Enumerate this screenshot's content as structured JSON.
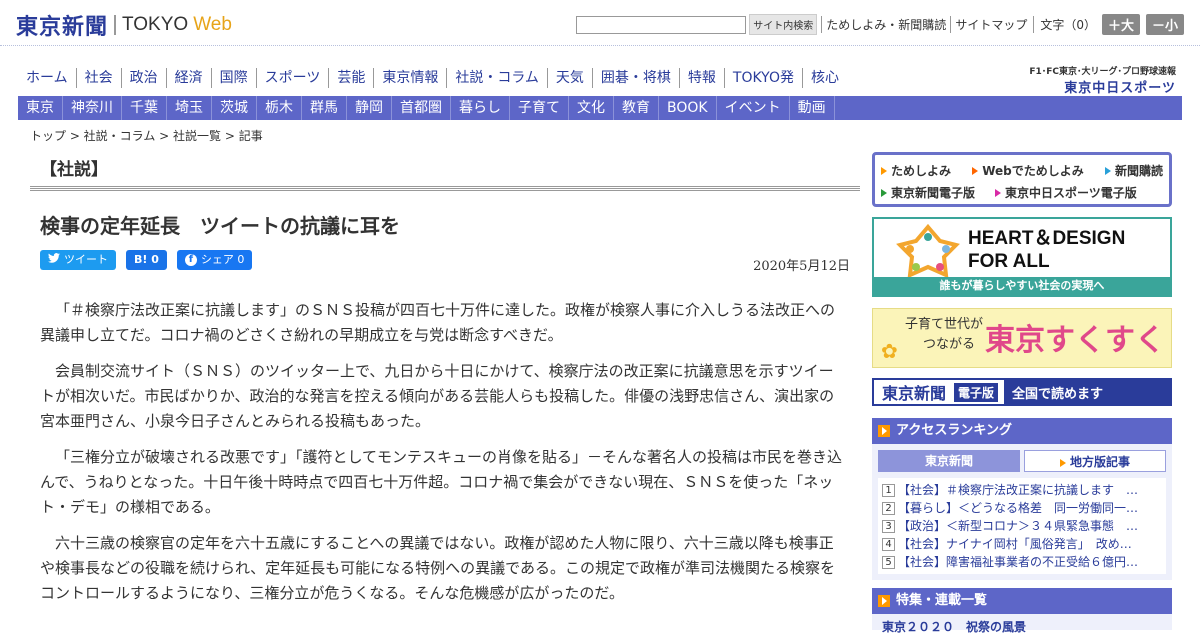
{
  "header": {
    "logo_jp": "東京新聞",
    "logo_en": "TOKYO",
    "logo_web": "Web",
    "search_button": "サイト内検索",
    "links": [
      "ためしよみ・新聞購読",
      "サイトマップ"
    ],
    "fontsize_label": "文字（0）",
    "size_up": "＋大",
    "size_down": "－小"
  },
  "nav_main": [
    "ホーム",
    "社会",
    "政治",
    "経済",
    "国際",
    "スポーツ",
    "芸能",
    "東京情報",
    "社説・コラム",
    "天気",
    "囲碁・将棋",
    "特報",
    "TOKYO発",
    "核心"
  ],
  "chunichi": {
    "small": "F1･FC東京･大リーグ･プロ野球速報",
    "big": "東京中日スポーツ"
  },
  "nav_sub": [
    "東京",
    "神奈川",
    "千葉",
    "埼玉",
    "茨城",
    "栃木",
    "群馬",
    "静岡",
    "首都圏",
    "暮らし",
    "子育て",
    "文化",
    "教育",
    "BOOK",
    "イベント",
    "動画"
  ],
  "breadcrumb": "トップ > 社説・コラム > 社説一覧 > 記事",
  "article": {
    "section": "【社説】",
    "headline": "検事の定年延長　ツイートの抗議に耳を",
    "share_tweet": "ツイート",
    "share_hatena": "B! 0",
    "share_facebook": "シェア 0",
    "date": "2020年5月12日",
    "paragraphs": [
      "「＃検察庁法改正案に抗議します」のＳＮＳ投稿が四百七十万件に達した。政権が検察人事に介入しうる法改正への異議申し立てだ。コロナ禍のどさくさ紛れの早期成立を与党は断念すべきだ。",
      "会員制交流サイト（ＳＮＳ）のツイッター上で、九日から十日にかけて、検察庁法の改正案に抗議意思を示すツイートが相次いだ。市民ばかりか、政治的な発言を控える傾向がある芸能人らも投稿した。俳優の浅野忠信さん、演出家の宮本亜門さん、小泉今日子さんとみられる投稿もあった。",
      "「三権分立が破壊される改悪です」「護符としてモンテスキューの肖像を貼る」－そんな著名人の投稿は市民を巻き込んで、うねりとなった。十日午後十時時点で四百七十万件超。コロナ禍で集会ができない現在、ＳＮＳを使った「ネット・デモ」の様相である。",
      "六十三歳の検察官の定年を六十五歳にすることへの異議ではない。政権が認めた人物に限り、六十三歳以降も検事正や検事長などの役職を続けられ、定年延長も可能になる特例への異議である。この規定で政権が準司法機関たる検察をコントロールするようになり、三権分立が危うくなる。そんな危機感が広がったのだ。"
    ]
  },
  "sidebar": {
    "links": [
      "ためしよみ",
      "Webでためしよみ",
      "新聞購読",
      "東京新聞電子版",
      "東京中日スポーツ電子版"
    ],
    "hd_title1": "HEART＆DESIGN",
    "hd_title2": "FOR ALL",
    "hd_caption": "誰もが暮らしやすい社会の実現へ",
    "suku_small1": "子育て世代が",
    "suku_small2": "つながる",
    "suku_big": "東京すくすく",
    "denshi_1": "東京新聞",
    "denshi_2": "電子版",
    "denshi_3": "全国で読めます",
    "ranking_title": "アクセスランキング",
    "ranking_tab1": "東京新聞",
    "ranking_tab2": "地方版記事",
    "ranking": [
      "【社会】＃検察庁法改正案に抗議します　…",
      "【暮らし】＜どうなる格差　同一労働同一…",
      "【政治】＜新型コロナ＞３４県緊急事態　…",
      "【社会】ナイナイ岡村「風俗発言」　改め…",
      "【社会】障害福祉事業者の不正受給６億円…"
    ],
    "special_title": "特集・連載一覧",
    "special_sub": "東京２０２０　祝祭の風景"
  },
  "colors": {
    "brand": "#2a3c9a",
    "nav_bar": "#5d66c8",
    "accent_orange": "#f90",
    "heart_design": "#3aa59a"
  }
}
